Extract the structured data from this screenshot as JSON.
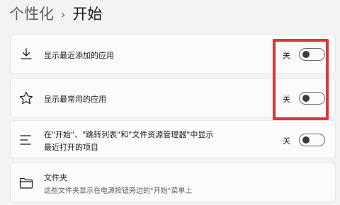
{
  "breadcrumb": {
    "parent": "个性化",
    "separator": "›",
    "current": "开始"
  },
  "settings": [
    {
      "icon": "download-icon",
      "label": "显示最近添加的应用",
      "state": "关",
      "toggle_on": false
    },
    {
      "icon": "star-icon",
      "label": "显示最常用的应用",
      "state": "关",
      "toggle_on": false
    },
    {
      "icon": "list-icon",
      "label_line1": "在\"开始\"、\"跳转列表\"和\"文件资源管理器\"中显示",
      "label_line2": "最近打开的项目",
      "state": "关",
      "toggle_on": false
    },
    {
      "icon": "folder-icon",
      "label": "文件夹",
      "description": "这些文件夹显示在电源按钮旁边的\"开始\"菜单上"
    }
  ],
  "colors": {
    "background": "#f3f3f3",
    "card": "#fbfbfb",
    "highlight": "#e3313b"
  }
}
